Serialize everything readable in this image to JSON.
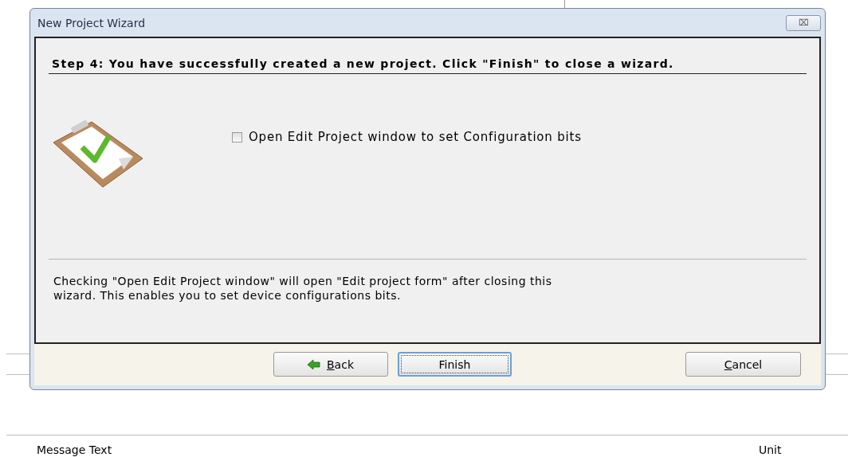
{
  "window": {
    "title": "New Project Wizard",
    "close": "⌧"
  },
  "step_title": "Step 4: You have successfully created a new project.  Click \"Finish\" to close a wizard.",
  "option": {
    "label": "Open Edit Project window to set Configuration bits",
    "checked": false
  },
  "description": "Checking \"Open Edit Project window\" will open \"Edit project form\" after closing this wizard. This enables you to set device configurations bits.",
  "buttons": [
    {
      "kind": "back",
      "label": "Back",
      "underline_first": true,
      "focused": false
    },
    {
      "kind": "finish",
      "label": "Finish",
      "underline_first": false,
      "focused": true
    },
    {
      "kind": "cancel",
      "label": "Cancel",
      "underline_first": true,
      "focused": false
    }
  ],
  "background_columns": [
    "Message Text",
    "Unit"
  ]
}
